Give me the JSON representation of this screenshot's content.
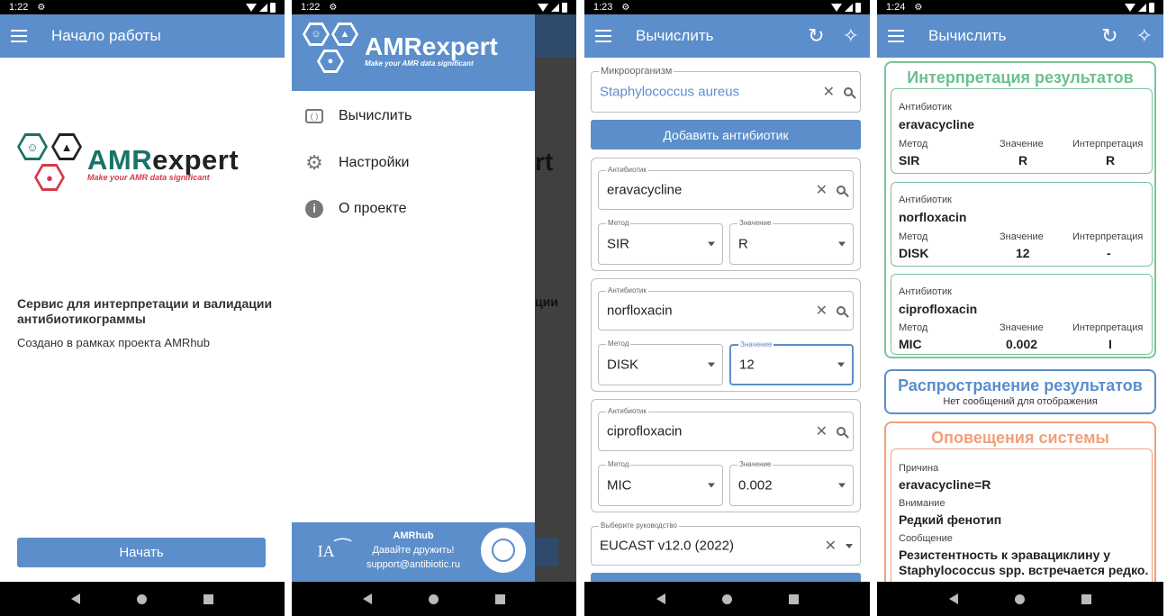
{
  "status": {
    "s1_time": "1:22",
    "s2_time": "1:22",
    "s3_time": "1:23",
    "s4_time": "1:24"
  },
  "colors": {
    "primary": "#5b8ecb",
    "green": "#6cc08f",
    "blue": "#5b8ecb",
    "orange": "#f0a07a"
  },
  "logo": {
    "text": "AMRexpert",
    "tagline": "Make your AMR data significant"
  },
  "screen1": {
    "title": "Начало работы",
    "headline": "Сервис для интерпретации и валидации антибиотикограммы",
    "subline": "Создано в рамках проекта AMRhub",
    "start_button": "Начать"
  },
  "screen2": {
    "menu": [
      {
        "label": "Вычислить",
        "icon": "calc-icon"
      },
      {
        "label": "Настройки",
        "icon": "gear-icon"
      },
      {
        "label": "О проекте",
        "icon": "info-icon"
      }
    ],
    "footer": {
      "title": "AMRhub",
      "line1": "Давайте дружить!",
      "line2": "support@antibiotic.ru"
    },
    "bg_fragments": {
      "rt": "rt",
      "tsii": "ции"
    }
  },
  "screen3": {
    "title": "Вычислить",
    "organism": {
      "label": "Микроорганизм",
      "value": "Staphylococcus aureus"
    },
    "add_button": "Добавить антибиотик",
    "antibiotics": [
      {
        "ab_label": "Антибиотик",
        "ab_value": "eravacycline",
        "method_label": "Метод",
        "method": "SIR",
        "value_label": "Значение",
        "value": "R"
      },
      {
        "ab_label": "Антибиотик",
        "ab_value": "norfloxacin",
        "method_label": "Метод",
        "method": "DISK",
        "value_label": "Значение",
        "value": "12"
      },
      {
        "ab_label": "Антибиотик",
        "ab_value": "ciprofloxacin",
        "method_label": "Метод",
        "method": "MIC",
        "value_label": "Значение",
        "value": "0.002"
      }
    ],
    "guideline": {
      "label": "Выберите руководство",
      "value": "EUCAST v12.0 (2022)"
    }
  },
  "screen4": {
    "title": "Вычислить",
    "interp_title": "Интерпретация результатов",
    "results": [
      {
        "ab_label": "Антибиотик",
        "ab": "eravacycline",
        "m_label": "Метод",
        "method": "SIR",
        "v_label": "Значение",
        "value": "R",
        "i_label": "Интерпретация",
        "interp": "R"
      },
      {
        "ab_label": "Антибиотик",
        "ab": "norfloxacin",
        "m_label": "Метод",
        "method": "DISK",
        "v_label": "Значение",
        "value": "12",
        "i_label": "Интерпретация",
        "interp": "-"
      },
      {
        "ab_label": "Антибиотик",
        "ab": "ciprofloxacin",
        "m_label": "Метод",
        "method": "MIC",
        "v_label": "Значение",
        "value": "0.002",
        "i_label": "Интерпретация",
        "interp": "I"
      }
    ],
    "dist_title": "Распространение результатов",
    "dist_text": "Нет сообщений для отображения",
    "alerts_title": "Оповещения системы",
    "alert": {
      "reason_label": "Причина",
      "reason": "eravacycline=R",
      "attention_label": "Внимание",
      "attention": "Редкий фенотип",
      "message_label": "Сообщение",
      "message": "Резистентность к эравациклину у Staphylococcus spp. встречается редко."
    }
  }
}
